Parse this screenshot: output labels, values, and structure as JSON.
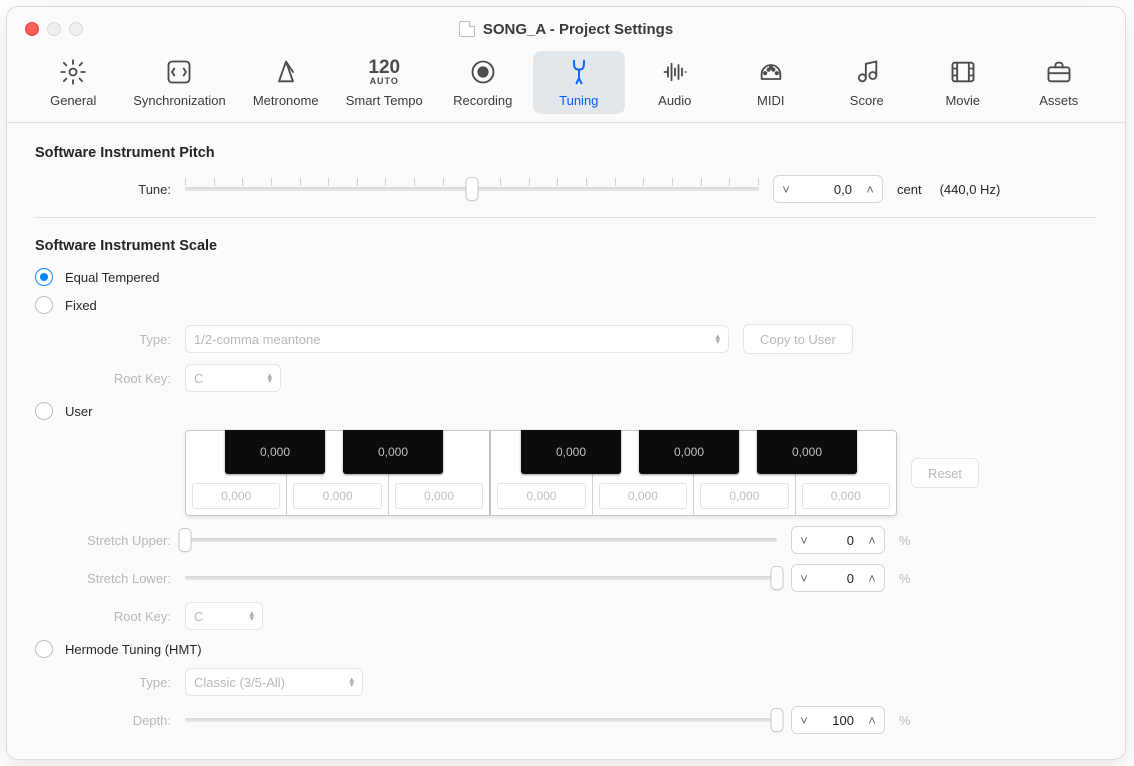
{
  "window": {
    "title": "SONG_A - Project Settings"
  },
  "toolbar": {
    "active_index": 5,
    "items": [
      {
        "id": "general",
        "label": "General"
      },
      {
        "id": "synchronization",
        "label": "Synchronization"
      },
      {
        "id": "metronome",
        "label": "Metronome"
      },
      {
        "id": "smart-tempo",
        "label": "Smart Tempo",
        "top": "120",
        "sub": "AUTO"
      },
      {
        "id": "recording",
        "label": "Recording"
      },
      {
        "id": "tuning",
        "label": "Tuning"
      },
      {
        "id": "audio",
        "label": "Audio"
      },
      {
        "id": "midi",
        "label": "MIDI"
      },
      {
        "id": "score",
        "label": "Score"
      },
      {
        "id": "movie",
        "label": "Movie"
      },
      {
        "id": "assets",
        "label": "Assets"
      }
    ]
  },
  "pitch": {
    "heading": "Software Instrument Pitch",
    "tune_label": "Tune:",
    "tune_value": "0,0",
    "tune_unit": "cent",
    "tune_freq": "(440,0 Hz)",
    "tune_percent": 50
  },
  "scale": {
    "heading": "Software Instrument Scale",
    "options": {
      "equal": "Equal Tempered",
      "fixed": "Fixed",
      "user": "User",
      "hermode": "Hermode Tuning (HMT)"
    },
    "selected": "equal",
    "fixed": {
      "type_label": "Type:",
      "type_value": "1/2-comma meantone",
      "copy_label": "Copy to User",
      "rootkey_label": "Root Key:",
      "rootkey_value": "C"
    },
    "user": {
      "reset_label": "Reset",
      "black_values": [
        "0,000",
        "0,000",
        "0,000",
        "0,000",
        "0,000"
      ],
      "white_values": [
        "0,000",
        "0,000",
        "0,000",
        "0,000",
        "0,000",
        "0,000",
        "0,000"
      ],
      "stretch_upper_label": "Stretch Upper:",
      "stretch_upper_value": "0",
      "stretch_upper_percent": 0,
      "stretch_lower_label": "Stretch Lower:",
      "stretch_lower_value": "0",
      "stretch_lower_percent": 100,
      "rootkey_label": "Root Key:",
      "rootkey_value": "C",
      "unit": "%"
    },
    "hermode": {
      "type_label": "Type:",
      "type_value": "Classic (3/5-All)",
      "depth_label": "Depth:",
      "depth_value": "100",
      "depth_percent": 100,
      "unit": "%"
    }
  }
}
